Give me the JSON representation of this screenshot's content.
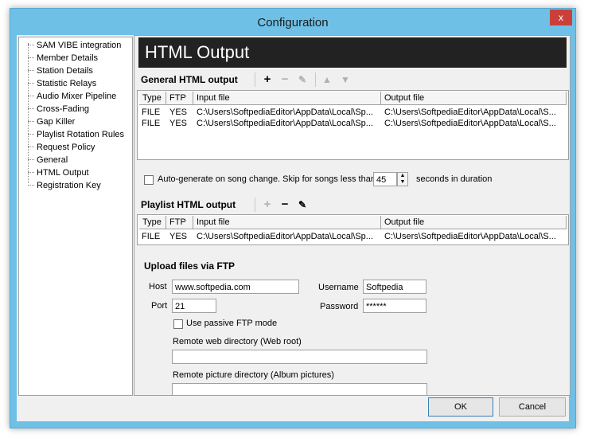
{
  "window": {
    "title": "Configuration",
    "close_label": "x"
  },
  "tree": {
    "items": [
      "SAM VIBE integration",
      "Member Details",
      "Station Details",
      "Statistic Relays",
      "Audio Mixer Pipeline",
      "Cross-Fading",
      "Gap Killer",
      "Playlist Rotation Rules",
      "Request Policy",
      "General",
      "HTML Output",
      "Registration Key"
    ]
  },
  "panel": {
    "title": "HTML Output",
    "general": {
      "label": "General HTML output",
      "columns": [
        "Type",
        "FTP",
        "Input file",
        "Output file"
      ],
      "rows": [
        [
          "FILE",
          "YES",
          "C:\\Users\\SoftpediaEditor\\AppData\\Local\\Sp...",
          "C:\\Users\\SoftpediaEditor\\AppData\\Local\\S..."
        ],
        [
          "FILE",
          "YES",
          "C:\\Users\\SoftpediaEditor\\AppData\\Local\\Sp...",
          "C:\\Users\\SoftpediaEditor\\AppData\\Local\\S..."
        ]
      ]
    },
    "autogen": {
      "label": "Auto-generate on song change. Skip for songs less than",
      "value": "45",
      "suffix": "seconds in duration"
    },
    "playlist": {
      "label": "Playlist HTML output",
      "columns": [
        "Type",
        "FTP",
        "Input file",
        "Output file"
      ],
      "rows": [
        [
          "FILE",
          "YES",
          "C:\\Users\\SoftpediaEditor\\AppData\\Local\\Sp...",
          "C:\\Users\\SoftpediaEditor\\AppData\\Local\\S..."
        ]
      ]
    },
    "ftp": {
      "title": "Upload files via FTP",
      "host_label": "Host",
      "host_value": "www.softpedia.com",
      "port_label": "Port",
      "port_value": "21",
      "username_label": "Username",
      "username_value": "Softpedia",
      "password_label": "Password",
      "password_value": "******",
      "passive_label": "Use passive FTP mode",
      "webdir_label": "Remote web directory (Web root)",
      "webdir_value": "",
      "picdir_label": "Remote picture directory (Album pictures)",
      "picdir_value": ""
    }
  },
  "footer": {
    "ok": "OK",
    "cancel": "Cancel"
  }
}
